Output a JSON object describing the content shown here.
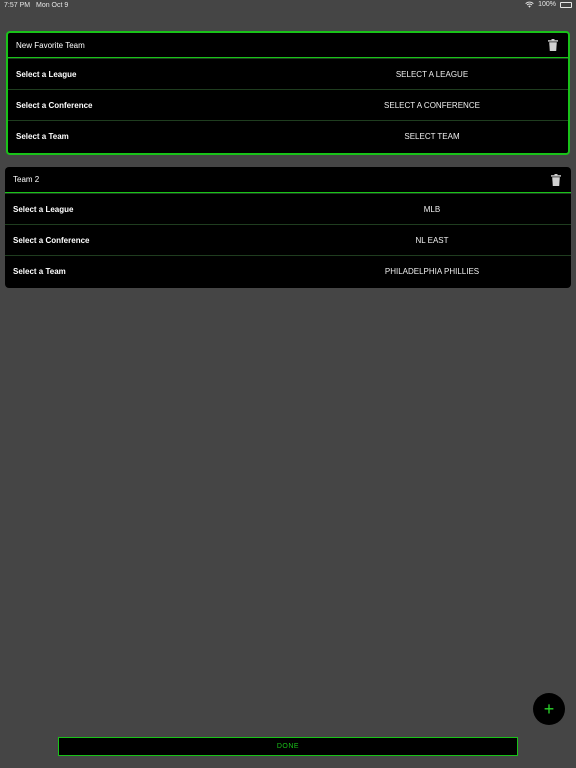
{
  "status_bar": {
    "time": "7:57 PM",
    "date": "Mon Oct 9",
    "battery": "100%"
  },
  "cards": [
    {
      "title": "New Favorite Team",
      "rows": [
        {
          "label": "Select a League",
          "value": "SELECT A LEAGUE"
        },
        {
          "label": "Select a Conference",
          "value": "SELECT A CONFERENCE"
        },
        {
          "label": "Select a Team",
          "value": "SELECT TEAM"
        }
      ]
    },
    {
      "title": "Team 2",
      "rows": [
        {
          "label": "Select a League",
          "value": "MLB"
        },
        {
          "label": "Select a Conference",
          "value": "NL EAST"
        },
        {
          "label": "Select a Team",
          "value": "PHILADELPHIA PHILLIES"
        }
      ]
    }
  ],
  "fab": {
    "label": "+",
    "icon": "plus-icon"
  },
  "done_button": {
    "label": "DONE"
  },
  "colors": {
    "background": "#454545",
    "card": "#000000",
    "accent": "#19c219"
  }
}
